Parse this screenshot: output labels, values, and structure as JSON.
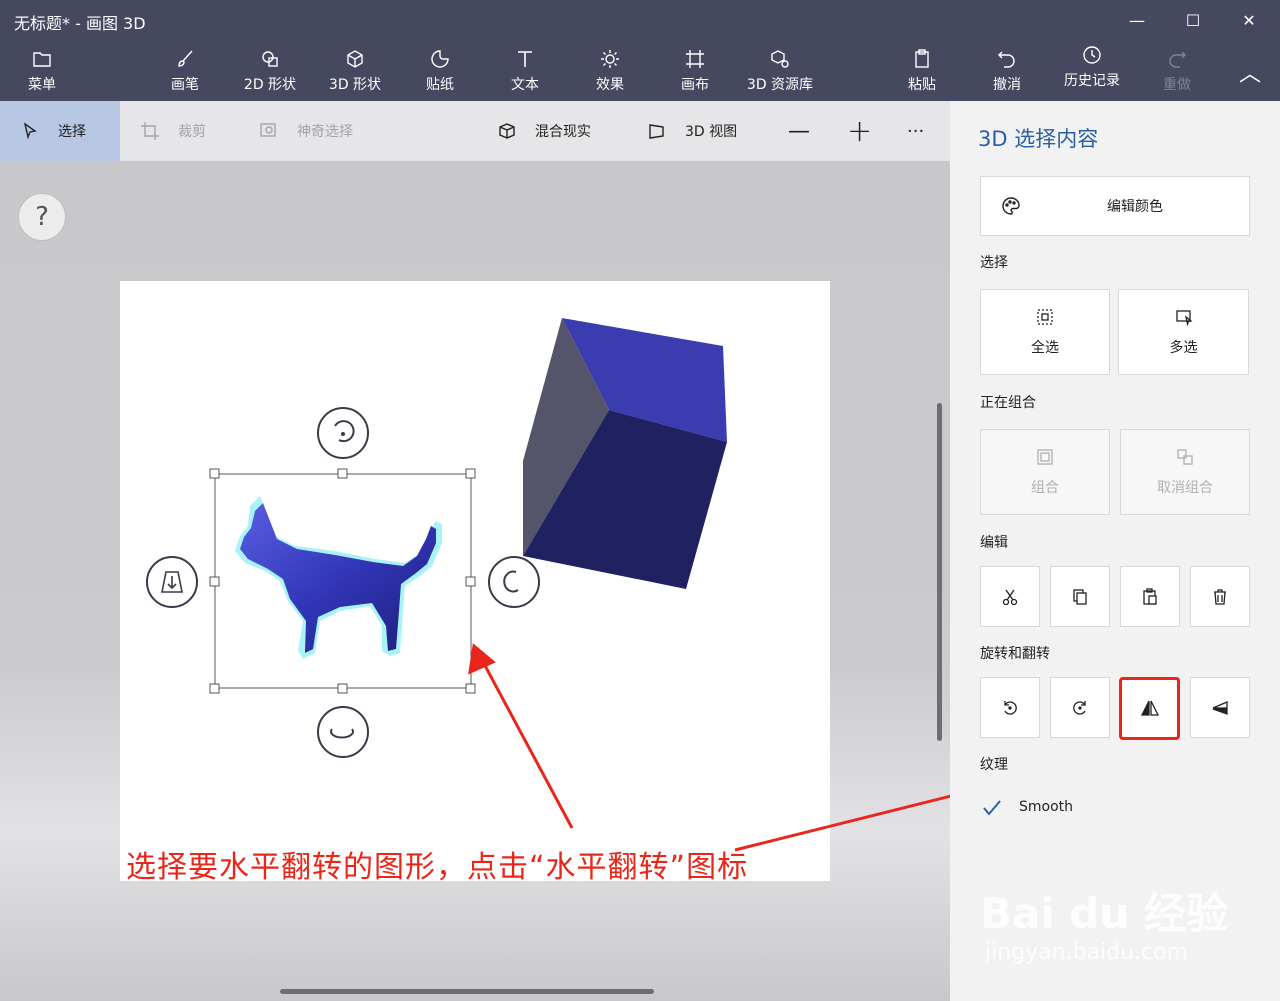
{
  "window": {
    "title": "无标题* - 画图 3D",
    "minimize": "—",
    "maximize": "☐",
    "close": "✕"
  },
  "ribbon": {
    "items": [
      {
        "label": "菜单",
        "icon": "folder-icon"
      },
      {
        "label": "画笔",
        "icon": "brush-icon"
      },
      {
        "label": "2D 形状",
        "icon": "2d-shapes-icon"
      },
      {
        "label": "3D 形状",
        "icon": "3d-shapes-icon"
      },
      {
        "label": "贴纸",
        "icon": "sticker-icon"
      },
      {
        "label": "文本",
        "icon": "text-icon"
      },
      {
        "label": "效果",
        "icon": "effects-icon"
      },
      {
        "label": "画布",
        "icon": "canvas-icon"
      },
      {
        "label": "3D 资源库",
        "icon": "3d-library-icon"
      },
      {
        "label": "粘贴",
        "icon": "paste-icon"
      },
      {
        "label": "撤消",
        "icon": "undo-icon"
      },
      {
        "label": "历史记录",
        "icon": "history-icon"
      },
      {
        "label": "重做",
        "icon": "redo-icon"
      }
    ],
    "collapse": "︿"
  },
  "toolbar": {
    "select": "选择",
    "crop": "裁剪",
    "magic_select": "神奇选择",
    "mixed_reality": "混合现实",
    "view_3d": "3D 视图",
    "zoom_out": "—",
    "zoom_in": "+",
    "more": "···"
  },
  "help": "?",
  "annotation": "选择要水平翻转的图形，点击“水平翻转”图标",
  "panel": {
    "title": "3D 选择内容",
    "edit_color": "编辑颜色",
    "select_label": "选择",
    "select_all": "全选",
    "multi_select": "多选",
    "group_label": "正在组合",
    "group": "组合",
    "ungroup": "取消组合",
    "edit_label": "编辑",
    "rotate_label": "旋转和翻转",
    "texture_label": "纹理",
    "smooth": "Smooth",
    "smooth_checked": true
  },
  "watermark": {
    "brand": "Bai du 经验",
    "url": "jingyan.baidu.com"
  },
  "colors": {
    "ribbon_bg": "#45485f",
    "accent": "#2a5fa8",
    "annotation": "#e8271a",
    "cat": "#3a3dbf",
    "cube": "#1f2160"
  }
}
